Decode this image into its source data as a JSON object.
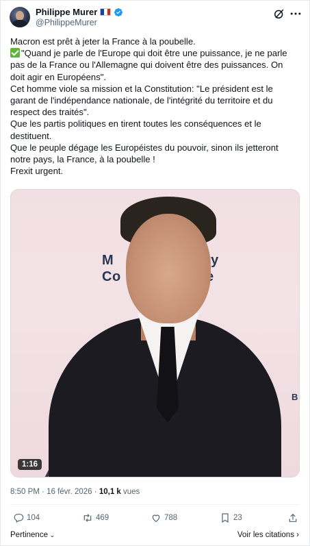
{
  "author": {
    "name": "Philippe Murer",
    "handle": "@PhilippeMurer",
    "flag_colors": [
      "#1e3fa8",
      "#ffffff",
      "#d52b1e"
    ],
    "verified_color": "#1d9bf0"
  },
  "header_icons": [
    "grok-icon",
    "more-icon"
  ],
  "tweet": {
    "lines": [
      "Macron est prêt à jeter la France à la poubelle.",
      "\"Quand je parle de l'Europe qui doit être une puissance, je ne parle pas de la France ou l'Allemagne qui doivent être des puissances. On doit agir en Européens\".",
      "Cet homme viole sa mission et la Constitution: \"Le président est le garant de l'indépendance nationale, de l'intégrité du territoire et du respect des traités\".",
      "Que les partis politiques en tirent toutes les conséquences et le destituent.",
      "Que le peuple dégage les Européistes du pouvoir, sinon ils jetteront notre pays, la France, à la poubelle !",
      "Frexit urgent."
    ]
  },
  "media": {
    "duration": "1:16",
    "background_text": [
      "M",
      "ty",
      "Co",
      "e",
      "B"
    ]
  },
  "meta": {
    "time": "8:50 PM",
    "separator": "·",
    "date": "16 févr. 2026",
    "views_count": "10,1 k",
    "views_label": "vues"
  },
  "actions": {
    "replies": "104",
    "reposts": "469",
    "likes": "788",
    "bookmarks": "23"
  },
  "footer": {
    "relevance": "Pertinence",
    "quotes": "Voir les citations"
  },
  "colors": {
    "text": "#0f1419",
    "secondary": "#536471",
    "check_emoji": "#5fb43a"
  }
}
